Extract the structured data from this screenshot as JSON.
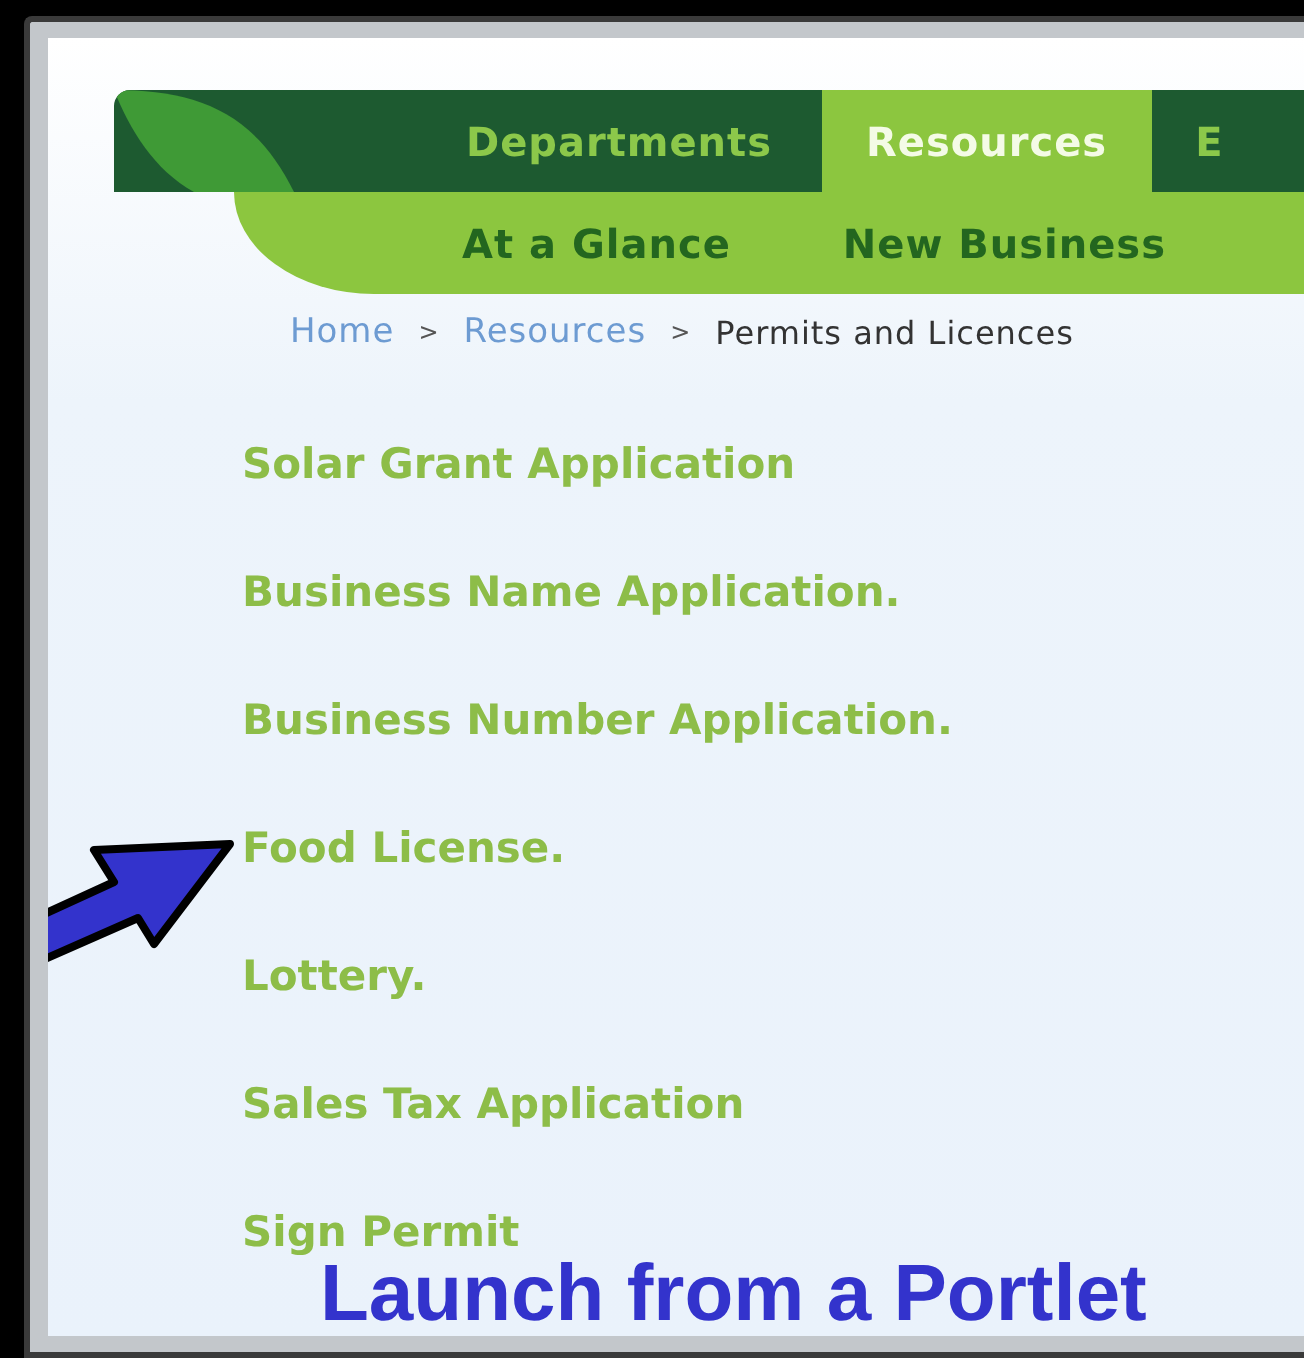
{
  "main_tabs": [
    {
      "label": "Departments",
      "selected": false
    },
    {
      "label": "Resources",
      "selected": true
    },
    {
      "label": "E",
      "selected": false
    }
  ],
  "sub_nav": [
    "At a Glance",
    "New Business"
  ],
  "breadcrumb": {
    "separator": ">",
    "items": [
      {
        "label": "Home",
        "kind": "link"
      },
      {
        "label": "Resources",
        "kind": "link"
      },
      {
        "label": "Permits and Licences",
        "kind": "current"
      }
    ]
  },
  "links": [
    "Solar Grant Application",
    "Business Name Application.",
    "Business Number Application.",
    "Food License.",
    "Lottery.",
    "Sales Tax Application",
    "Sign Permit"
  ],
  "annotation": {
    "caption": "Launch from a Portlet"
  }
}
